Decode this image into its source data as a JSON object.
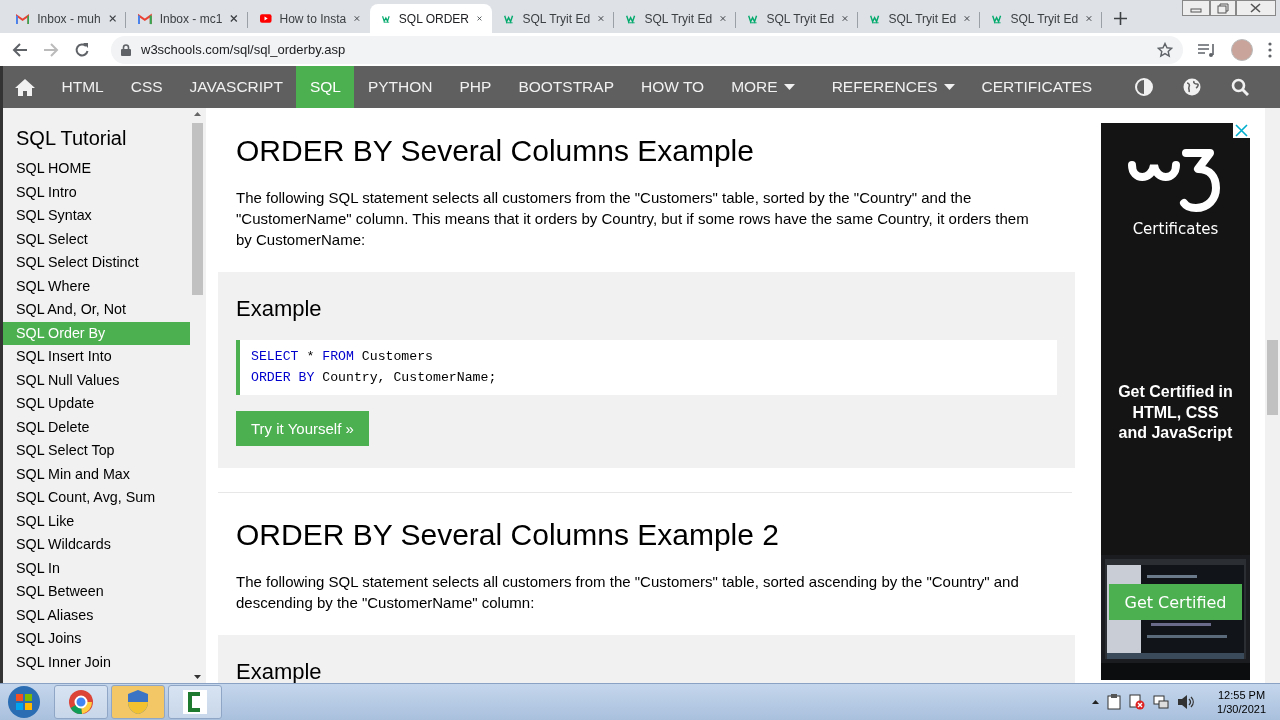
{
  "browser": {
    "tabs": [
      {
        "kind": "mail",
        "title": "Inbox - muh",
        "selected": false
      },
      {
        "kind": "mail",
        "title": "Inbox - mc1",
        "selected": false
      },
      {
        "kind": "video",
        "title": "How to Insta",
        "selected": false
      },
      {
        "kind": "site",
        "title": "SQL ORDER",
        "selected": true
      },
      {
        "kind": "site",
        "title": "SQL Tryit Ed",
        "selected": false
      },
      {
        "kind": "site",
        "title": "SQL Tryit Ed",
        "selected": false
      },
      {
        "kind": "site",
        "title": "SQL Tryit Ed",
        "selected": false
      },
      {
        "kind": "site",
        "title": "SQL Tryit Ed",
        "selected": false
      },
      {
        "kind": "site",
        "title": "SQL Tryit Ed",
        "selected": false
      }
    ],
    "url": "w3schools.com/sql/sql_orderby.asp"
  },
  "nav": {
    "items": [
      {
        "label": "HTML",
        "selected": false,
        "dropdown": false
      },
      {
        "label": "CSS",
        "selected": false,
        "dropdown": false
      },
      {
        "label": "JAVASCRIPT",
        "selected": false,
        "dropdown": false
      },
      {
        "label": "SQL",
        "selected": true,
        "dropdown": false
      },
      {
        "label": "PYTHON",
        "selected": false,
        "dropdown": false
      },
      {
        "label": "PHP",
        "selected": false,
        "dropdown": false
      },
      {
        "label": "BOOTSTRAP",
        "selected": false,
        "dropdown": false
      },
      {
        "label": "HOW TO",
        "selected": false,
        "dropdown": false
      },
      {
        "label": "MORE",
        "selected": false,
        "dropdown": true
      },
      {
        "label": "REFERENCES",
        "selected": false,
        "dropdown": true
      },
      {
        "label": "CERTIFICATES",
        "selected": false,
        "dropdown": false
      }
    ]
  },
  "sidebar": {
    "title": "SQL Tutorial",
    "items": [
      {
        "label": "SQL HOME",
        "selected": false
      },
      {
        "label": "SQL Intro",
        "selected": false
      },
      {
        "label": "SQL Syntax",
        "selected": false
      },
      {
        "label": "SQL Select",
        "selected": false
      },
      {
        "label": "SQL Select Distinct",
        "selected": false
      },
      {
        "label": "SQL Where",
        "selected": false
      },
      {
        "label": "SQL And, Or, Not",
        "selected": false
      },
      {
        "label": "SQL Order By",
        "selected": true
      },
      {
        "label": "SQL Insert Into",
        "selected": false
      },
      {
        "label": "SQL Null Values",
        "selected": false
      },
      {
        "label": "SQL Update",
        "selected": false
      },
      {
        "label": "SQL Delete",
        "selected": false
      },
      {
        "label": "SQL Select Top",
        "selected": false
      },
      {
        "label": "SQL Min and Max",
        "selected": false
      },
      {
        "label": "SQL Count, Avg, Sum",
        "selected": false
      },
      {
        "label": "SQL Like",
        "selected": false
      },
      {
        "label": "SQL Wildcards",
        "selected": false
      },
      {
        "label": "SQL In",
        "selected": false
      },
      {
        "label": "SQL Between",
        "selected": false
      },
      {
        "label": "SQL Aliases",
        "selected": false
      },
      {
        "label": "SQL Joins",
        "selected": false
      },
      {
        "label": "SQL Inner Join",
        "selected": false
      }
    ]
  },
  "content": {
    "sections": [
      {
        "title": "ORDER BY Several Columns Example",
        "text": "The following SQL statement selects all customers from the \"Customers\" table, sorted by the \"Country\" and the \"CustomerName\" column. This means that it orders by Country, but if some rows have the same Country, it orders them by CustomerName:",
        "example": {
          "title": "Example",
          "code": [
            [
              {
                "kind": "keyword",
                "text": "SELECT"
              },
              {
                "kind": "plain",
                "text": " * "
              },
              {
                "kind": "keyword",
                "text": "FROM"
              },
              {
                "kind": "plain",
                "text": " Customers"
              }
            ],
            [
              {
                "kind": "keyword",
                "text": "ORDER BY"
              },
              {
                "kind": "plain",
                "text": " Country, CustomerName;"
              }
            ]
          ],
          "button": "Try it Yourself »"
        }
      },
      {
        "title": "ORDER BY Several Columns Example 2",
        "text": "The following SQL statement selects all customers from the \"Customers\" table, sorted ascending by the \"Country\" and descending by the \"CustomerName\" column:",
        "example": {
          "title": "Example"
        }
      }
    ]
  },
  "ad": {
    "brand": "Certificates",
    "headline": "Get Certified in HTML, CSS and JavaScript",
    "button": "Get Certified"
  },
  "taskbar": {
    "time": "12:55 PM",
    "date": "1/30/2021"
  }
}
